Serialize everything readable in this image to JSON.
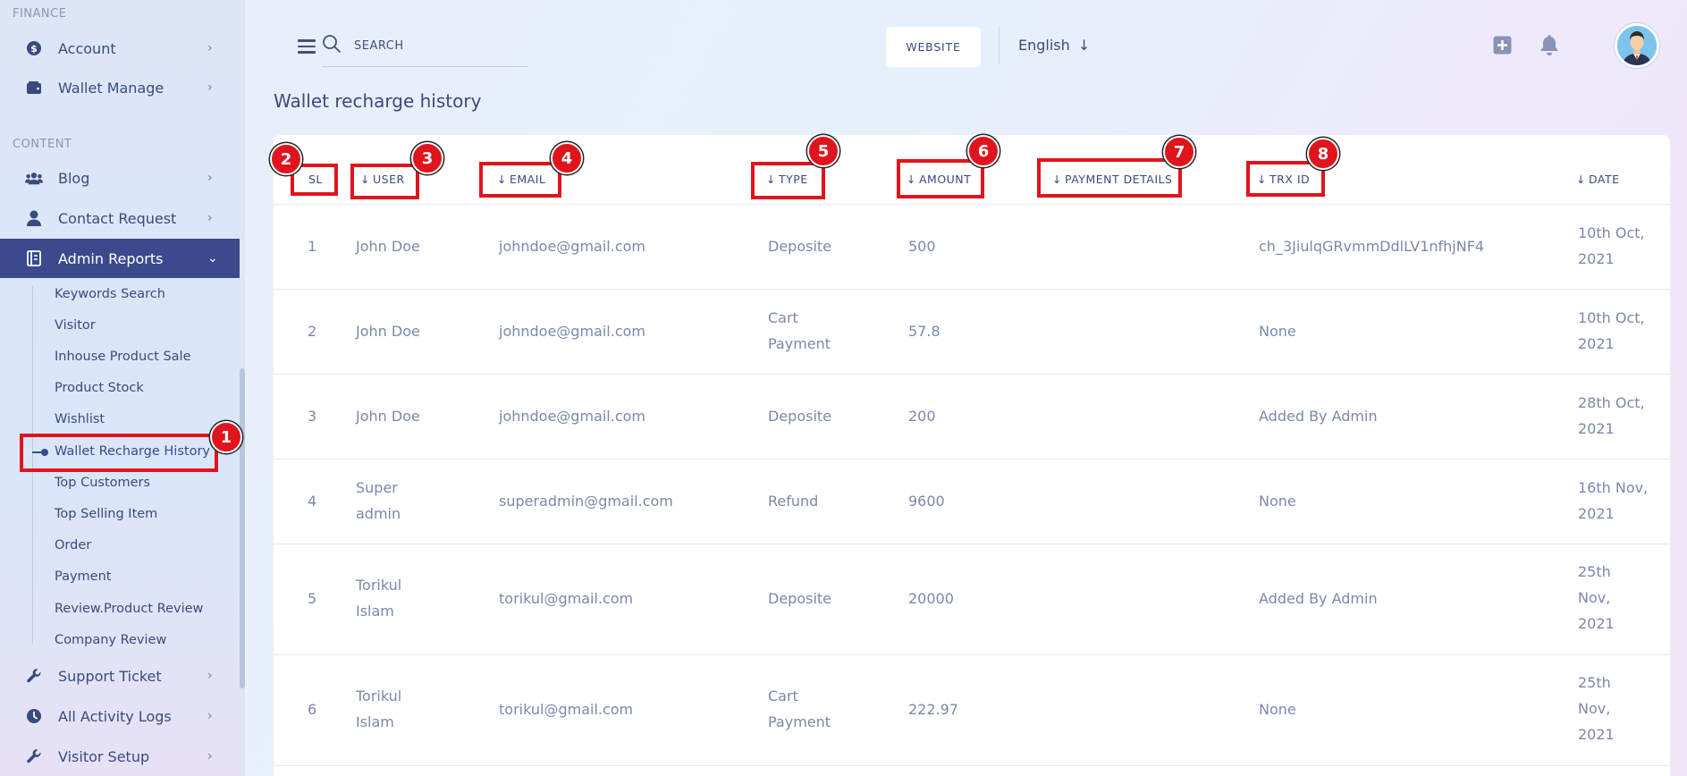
{
  "sidebar": {
    "section_finance": "FINANCE",
    "section_content": "CONTENT",
    "menu": {
      "account": "Account",
      "wallet_manage": "Wallet Manage",
      "blog": "Blog",
      "contact_request": "Contact Request",
      "admin_reports": "Admin Reports",
      "support_ticket": "Support Ticket",
      "activity_logs": "All Activity Logs",
      "visitor_setup": "Visitor Setup"
    },
    "submenu": [
      "Keywords Search",
      "Visitor",
      "Inhouse Product Sale",
      "Product Stock",
      "Wishlist",
      "Wallet Recharge History",
      "Top Customers",
      "Top Selling Item",
      "Order",
      "Payment",
      "Review.Product Review",
      "Company Review"
    ]
  },
  "topbar": {
    "search_placeholder": "SEARCH",
    "website_button": "WEBSITE",
    "language": "English"
  },
  "page": {
    "title": "Wallet recharge history"
  },
  "table": {
    "headers": [
      "SL",
      "USER",
      "EMAIL",
      "TYPE",
      "AMOUNT",
      "PAYMENT DETAILS",
      "TRX ID",
      "DATE"
    ],
    "rows": [
      [
        "1",
        "John Doe",
        "johndoe@gmail.com",
        "Deposite",
        "500",
        "",
        "ch_3JiulqGRvmmDdlLV1nfhjNF4",
        "10th Oct, 2021"
      ],
      [
        "2",
        "John Doe",
        "johndoe@gmail.com",
        "Cart Payment",
        "57.8",
        "",
        "None",
        "10th Oct, 2021"
      ],
      [
        "3",
        "John Doe",
        "johndoe@gmail.com",
        "Deposite",
        "200",
        "",
        "Added By Admin",
        "28th Oct, 2021"
      ],
      [
        "4",
        "Super admin",
        "superadmin@gmail.com",
        "Refund",
        "9600",
        "",
        "None",
        "16th Nov, 2021"
      ],
      [
        "5",
        "Torikul Islam",
        "torikul@gmail.com",
        "Deposite",
        "20000",
        "",
        "Added By Admin",
        "25th Nov, 2021"
      ],
      [
        "6",
        "Torikul Islam",
        "torikul@gmail.com",
        "Cart Payment",
        "222.97",
        "",
        "None",
        "25th Nov, 2021"
      ]
    ]
  },
  "annotations": [
    "1",
    "2",
    "3",
    "4",
    "5",
    "6",
    "7",
    "8"
  ],
  "colors": {
    "accent": "#3a4a8c",
    "highlight": "#e0141c"
  }
}
